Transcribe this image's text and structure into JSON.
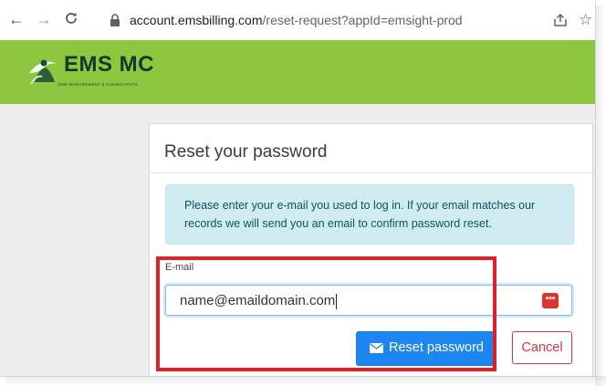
{
  "browser": {
    "url_host": "account.emsbilling.com",
    "url_path": "/reset-request?appId=emsight-prod",
    "back_glyph": "←",
    "forward_glyph": "→",
    "star_glyph": "☆",
    "icons": [
      "back-arrow-icon",
      "forward-arrow-icon",
      "reload-icon",
      "lock-icon",
      "share-icon",
      "bookmark-star-icon"
    ]
  },
  "site": {
    "logo_text": "EMS MC",
    "logo_subtitle": "EMS MANAGEMENT & CONSULTANTS",
    "header_color": "#8dc63f"
  },
  "form": {
    "title": "Reset your password",
    "info_message": "Please enter your e-mail you used to log in. If your email matches our records we will send you an email to confirm password reset.",
    "email_label": "E-mail",
    "email_value": "name@emaildomain.com",
    "password_manager_glyph": "•••",
    "reset_button_label": "Reset password",
    "cancel_button_label": "Cancel",
    "primary_color": "#1d86f0",
    "cancel_color": "#dc3545"
  },
  "annotation": {
    "highlight_color": "#e31e24"
  }
}
